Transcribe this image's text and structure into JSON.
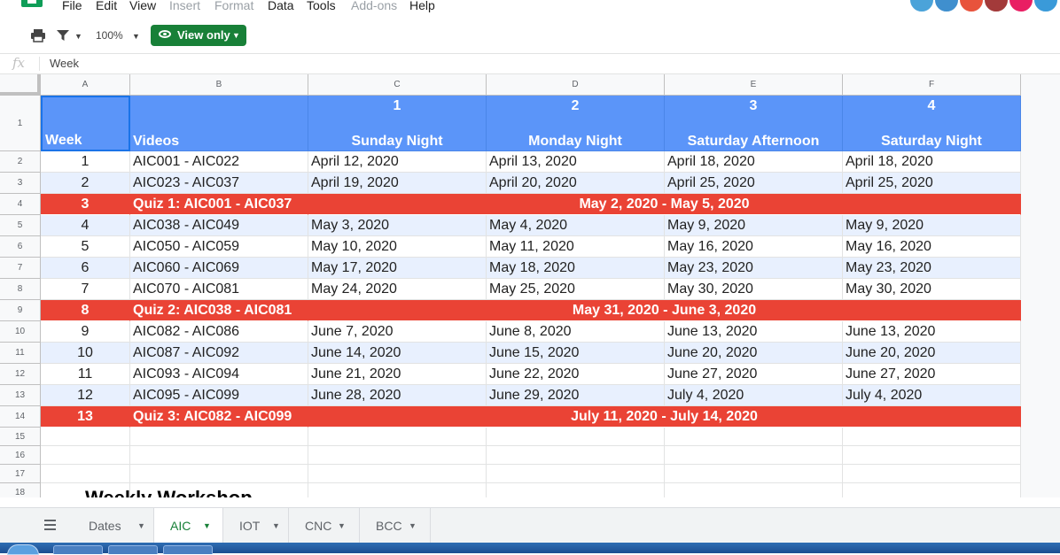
{
  "menu": [
    "File",
    "Edit",
    "View",
    "Insert",
    "Format",
    "Data",
    "Tools",
    "Add-ons",
    "Help"
  ],
  "menu_dim": [
    false,
    false,
    false,
    true,
    true,
    false,
    false,
    true,
    false
  ],
  "toolbar": {
    "zoom": "100%",
    "view_only": "View only"
  },
  "formula": {
    "fx": "fx",
    "value": "Week"
  },
  "columns": [
    "A",
    "B",
    "C",
    "D",
    "E",
    "F"
  ],
  "header": {
    "row_num": "1",
    "week": "Week",
    "videos": "Videos",
    "slots": [
      {
        "num": "1",
        "name": "Sunday Night"
      },
      {
        "num": "2",
        "name": "Monday Night"
      },
      {
        "num": "3",
        "name": "Saturday Afternoon"
      },
      {
        "num": "4",
        "name": "Saturday Night"
      }
    ]
  },
  "rows": [
    {
      "row": "2",
      "type": "data",
      "week": "1",
      "videos": "AIC001 - AIC022",
      "dates": [
        "April 12, 2020",
        "April 13, 2020",
        "April 18, 2020",
        "April 18, 2020"
      ]
    },
    {
      "row": "3",
      "type": "data",
      "week": "2",
      "videos": "AIC023 - AIC037",
      "dates": [
        "April 19, 2020",
        "April 20, 2020",
        "April 25, 2020",
        "April 25, 2020"
      ]
    },
    {
      "row": "4",
      "type": "quiz",
      "week": "3",
      "videos": "Quiz 1: AIC001 - AIC037",
      "range": "May 2, 2020 - May 5, 2020"
    },
    {
      "row": "5",
      "type": "data",
      "week": "4",
      "videos": "AIC038 - AIC049",
      "dates": [
        "May 3, 2020",
        "May 4, 2020",
        "May 9, 2020",
        "May 9, 2020"
      ]
    },
    {
      "row": "6",
      "type": "data",
      "week": "5",
      "videos": "AIC050 - AIC059",
      "dates": [
        "May 10, 2020",
        "May 11, 2020",
        "May 16, 2020",
        "May 16, 2020"
      ]
    },
    {
      "row": "7",
      "type": "data",
      "week": "6",
      "videos": "AIC060 - AIC069",
      "dates": [
        "May 17, 2020",
        "May 18, 2020",
        "May 23, 2020",
        "May 23, 2020"
      ]
    },
    {
      "row": "8",
      "type": "data",
      "week": "7",
      "videos": "AIC070 - AIC081",
      "dates": [
        "May 24, 2020",
        "May 25, 2020",
        "May 30, 2020",
        "May 30, 2020"
      ]
    },
    {
      "row": "9",
      "type": "quiz",
      "week": "8",
      "videos": "Quiz 2: AIC038 - AIC081",
      "range": "May 31, 2020 - June 3, 2020"
    },
    {
      "row": "10",
      "type": "data",
      "week": "9",
      "videos": "AIC082 - AIC086",
      "dates": [
        "June 7, 2020",
        "June 8, 2020",
        "June 13, 2020",
        "June 13, 2020"
      ]
    },
    {
      "row": "11",
      "type": "data",
      "week": "10",
      "videos": "AIC087 - AIC092",
      "dates": [
        "June 14, 2020",
        "June 15, 2020",
        "June 20, 2020",
        "June 20, 2020"
      ]
    },
    {
      "row": "12",
      "type": "data",
      "week": "11",
      "videos": "AIC093 - AIC094",
      "dates": [
        "June 21, 2020",
        "June 22, 2020",
        "June 27, 2020",
        "June 27, 2020"
      ]
    },
    {
      "row": "13",
      "type": "data",
      "week": "12",
      "videos": "AIC095 - AIC099",
      "dates": [
        "June 28, 2020",
        "June 29, 2020",
        "July 4, 2020",
        "July 4, 2020"
      ]
    },
    {
      "row": "14",
      "type": "quiz",
      "week": "13",
      "videos": "Quiz 3: AIC082 - AIC099",
      "range": "July 11, 2020 - July 14, 2020"
    }
  ],
  "empty_rows": [
    "15",
    "16",
    "17",
    "18"
  ],
  "partial_text": "Weekly Workshop",
  "sheets": [
    {
      "name": "Dates",
      "active": false
    },
    {
      "name": "AIC",
      "active": true
    },
    {
      "name": "IOT",
      "active": false
    },
    {
      "name": "CNC",
      "active": false
    },
    {
      "name": "BCC",
      "active": false
    }
  ],
  "colors": {
    "header_blue": "#5b95f9",
    "quiz_red": "#ea4335",
    "band_blue": "#e8f0fe",
    "accent_green": "#188038"
  }
}
